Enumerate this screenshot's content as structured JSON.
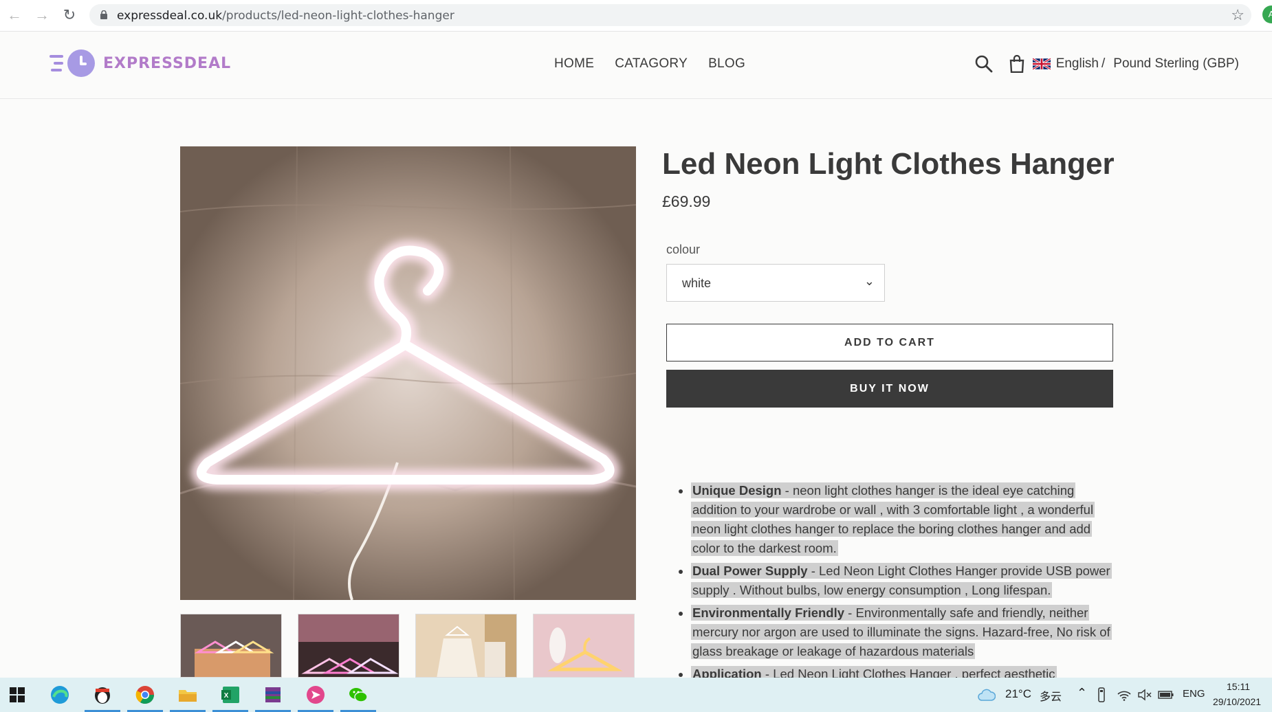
{
  "browser": {
    "url_domain": "expressdeal.co.uk",
    "url_path": "/products/led-neon-light-clothes-hanger",
    "profile_initial": "A"
  },
  "header": {
    "logo_text": "EXPRESSDEAL",
    "nav": [
      "HOME",
      "CATAGORY",
      "BLOG"
    ],
    "language": "English",
    "lang_sep": "/",
    "currency": "Pound Sterling (GBP)"
  },
  "product": {
    "title": "Led Neon Light Clothes Hanger",
    "price": "£69.99",
    "colour_label": "colour",
    "colour_value": "white",
    "add_to_cart": "ADD TO CART",
    "buy_now": "BUY IT NOW"
  },
  "description": [
    {
      "heading": "Unique Design",
      "sep": " - ",
      "text": " neon light clothes hanger is the ideal eye catching addition to your wardrobe or wall , with 3 comfortable light , a wonderful neon light clothes hanger to replace the boring clothes hanger and add color to the darkest room."
    },
    {
      "heading": "Dual Power Supply",
      "sep": " - ",
      "text": "Led Neon Light Clothes Hanger provide USB power supply . Without bulbs, low energy consumption , Long lifespan."
    },
    {
      "heading": "Environmentally Friendly",
      "sep": " - ",
      "text": "Environmentally safe and friendly, neither mercury nor argon are used to illuminate the signs. Hazard-free, No risk of glass breakage or leakage of hazardous materials"
    },
    {
      "heading": "Application",
      "sep": " - ",
      "text": "Led Neon Light Clothes Hanger , perfect aesthetic"
    }
  ],
  "taskbar": {
    "weather": "21°C",
    "weather_desc": "多云",
    "lang": "ENG",
    "time": "15:11",
    "date": "29/10/2021"
  },
  "colors": {
    "accent_logo": "#b27bc9",
    "button_dark": "#3a3a3a",
    "highlight": "#cfcfcf"
  }
}
